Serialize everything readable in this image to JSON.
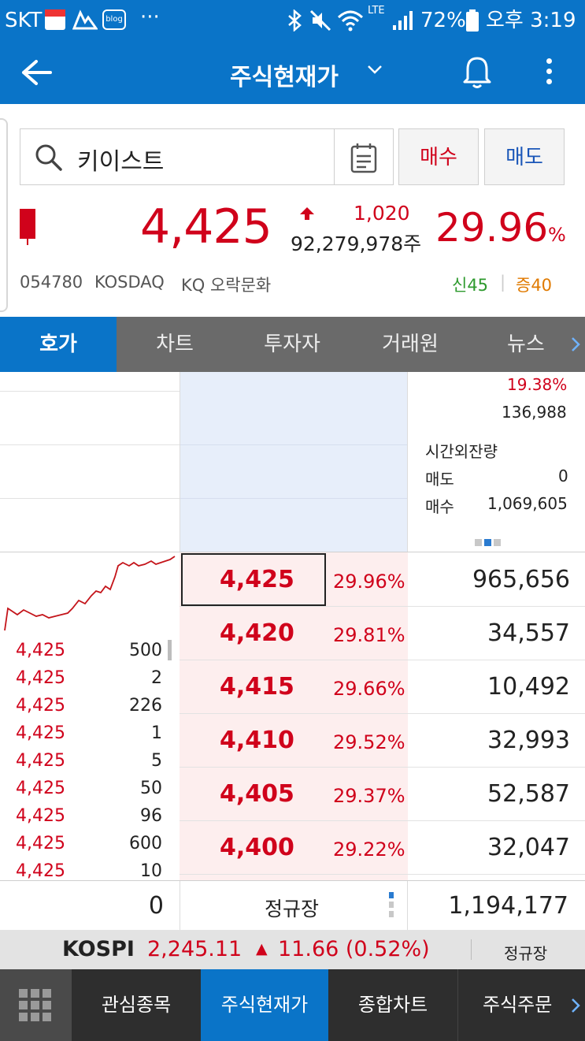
{
  "status_bar": {
    "carrier": "SKT",
    "app_badges": [
      "MY NEWS PICKER",
      "blog"
    ],
    "overflow": "···",
    "lte": "LTE",
    "battery": "72%",
    "time": "오후 3:19"
  },
  "app_bar": {
    "back_icon": "arrow-left-icon",
    "title": "주식현재가",
    "bell_icon": "bell-icon",
    "menu_icon": "more-vertical-icon"
  },
  "stock": {
    "search_value": "키이스트",
    "buy_label": "매수",
    "sell_label": "매도",
    "price": "4,425",
    "change": "1,020",
    "volume": "92,279,978주",
    "change_pct": "29.96",
    "pct_sign": "%",
    "code": "054780",
    "market": "KOSDAQ",
    "sector": "KQ 오락문화",
    "new_high": "신45",
    "separator": "|",
    "increase": "증40"
  },
  "tabs": {
    "items": [
      "호가",
      "차트",
      "투자자",
      "거래원",
      "뉴스"
    ],
    "active": "호가",
    "more_icon": "chevron-right-icon"
  },
  "book": {
    "right_top": {
      "pct": "19.38%",
      "value": "136,988",
      "after_hours_label": "시간외잔량",
      "sell_label": "매도",
      "sell_value": "0",
      "buy_label": "매수",
      "buy_value": "1,069,605"
    },
    "bids": [
      {
        "price": "4,425",
        "pct": "29.96%",
        "qty": "965,656"
      },
      {
        "price": "4,420",
        "pct": "29.81%",
        "qty": "34,557"
      },
      {
        "price": "4,415",
        "pct": "29.66%",
        "qty": "10,492"
      },
      {
        "price": "4,410",
        "pct": "29.52%",
        "qty": "32,993"
      },
      {
        "price": "4,405",
        "pct": "29.37%",
        "qty": "52,587"
      },
      {
        "price": "4,400",
        "pct": "29.22%",
        "qty": "32,047"
      }
    ],
    "trades": [
      {
        "price": "4,425",
        "qty": "500"
      },
      {
        "price": "4,425",
        "qty": "2"
      },
      {
        "price": "4,425",
        "qty": "226"
      },
      {
        "price": "4,425",
        "qty": "1"
      },
      {
        "price": "4,425",
        "qty": "5"
      },
      {
        "price": "4,425",
        "qty": "50"
      },
      {
        "price": "4,425",
        "qty": "96"
      },
      {
        "price": "4,425",
        "qty": "600"
      },
      {
        "price": "4,425",
        "qty": "10"
      }
    ]
  },
  "footer": {
    "left_total": "0",
    "session": "정규장",
    "right_total": "1,194,177"
  },
  "index": {
    "name": "KOSPI",
    "value": "2,245.11",
    "arrow": "▲",
    "change": "11.66 (0.52%)",
    "session": "정규장"
  },
  "bottom_nav": {
    "menu_icon": "grid-menu-icon",
    "items": [
      "관심종목",
      "주식현재가",
      "종합차트",
      "주식주문"
    ],
    "active": "주식현재가"
  },
  "colors": {
    "brand": "#0a74c8",
    "up": "#d0021b",
    "down": "#1a56b8",
    "green": "#2e9a2e",
    "orange": "#e07a00"
  }
}
